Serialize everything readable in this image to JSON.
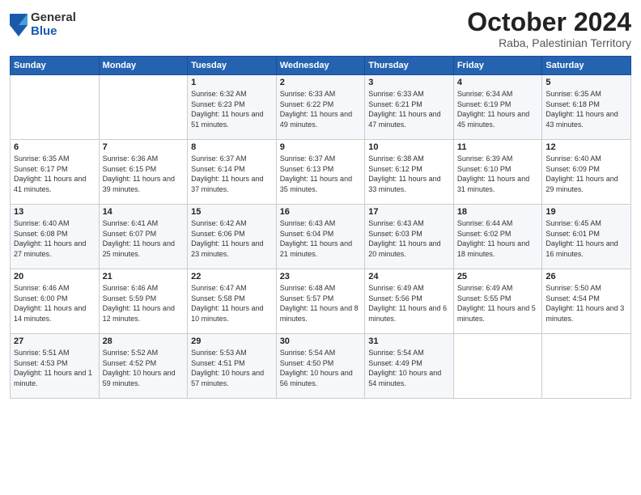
{
  "header": {
    "logo": {
      "general": "General",
      "blue": "Blue"
    },
    "title": "October 2024",
    "location": "Raba, Palestinian Territory"
  },
  "days_of_week": [
    "Sunday",
    "Monday",
    "Tuesday",
    "Wednesday",
    "Thursday",
    "Friday",
    "Saturday"
  ],
  "weeks": [
    [
      {
        "day": "",
        "sunrise": "",
        "sunset": "",
        "daylight": ""
      },
      {
        "day": "",
        "sunrise": "",
        "sunset": "",
        "daylight": ""
      },
      {
        "day": "1",
        "sunrise": "Sunrise: 6:32 AM",
        "sunset": "Sunset: 6:23 PM",
        "daylight": "Daylight: 11 hours and 51 minutes."
      },
      {
        "day": "2",
        "sunrise": "Sunrise: 6:33 AM",
        "sunset": "Sunset: 6:22 PM",
        "daylight": "Daylight: 11 hours and 49 minutes."
      },
      {
        "day": "3",
        "sunrise": "Sunrise: 6:33 AM",
        "sunset": "Sunset: 6:21 PM",
        "daylight": "Daylight: 11 hours and 47 minutes."
      },
      {
        "day": "4",
        "sunrise": "Sunrise: 6:34 AM",
        "sunset": "Sunset: 6:19 PM",
        "daylight": "Daylight: 11 hours and 45 minutes."
      },
      {
        "day": "5",
        "sunrise": "Sunrise: 6:35 AM",
        "sunset": "Sunset: 6:18 PM",
        "daylight": "Daylight: 11 hours and 43 minutes."
      }
    ],
    [
      {
        "day": "6",
        "sunrise": "Sunrise: 6:35 AM",
        "sunset": "Sunset: 6:17 PM",
        "daylight": "Daylight: 11 hours and 41 minutes."
      },
      {
        "day": "7",
        "sunrise": "Sunrise: 6:36 AM",
        "sunset": "Sunset: 6:15 PM",
        "daylight": "Daylight: 11 hours and 39 minutes."
      },
      {
        "day": "8",
        "sunrise": "Sunrise: 6:37 AM",
        "sunset": "Sunset: 6:14 PM",
        "daylight": "Daylight: 11 hours and 37 minutes."
      },
      {
        "day": "9",
        "sunrise": "Sunrise: 6:37 AM",
        "sunset": "Sunset: 6:13 PM",
        "daylight": "Daylight: 11 hours and 35 minutes."
      },
      {
        "day": "10",
        "sunrise": "Sunrise: 6:38 AM",
        "sunset": "Sunset: 6:12 PM",
        "daylight": "Daylight: 11 hours and 33 minutes."
      },
      {
        "day": "11",
        "sunrise": "Sunrise: 6:39 AM",
        "sunset": "Sunset: 6:10 PM",
        "daylight": "Daylight: 11 hours and 31 minutes."
      },
      {
        "day": "12",
        "sunrise": "Sunrise: 6:40 AM",
        "sunset": "Sunset: 6:09 PM",
        "daylight": "Daylight: 11 hours and 29 minutes."
      }
    ],
    [
      {
        "day": "13",
        "sunrise": "Sunrise: 6:40 AM",
        "sunset": "Sunset: 6:08 PM",
        "daylight": "Daylight: 11 hours and 27 minutes."
      },
      {
        "day": "14",
        "sunrise": "Sunrise: 6:41 AM",
        "sunset": "Sunset: 6:07 PM",
        "daylight": "Daylight: 11 hours and 25 minutes."
      },
      {
        "day": "15",
        "sunrise": "Sunrise: 6:42 AM",
        "sunset": "Sunset: 6:06 PM",
        "daylight": "Daylight: 11 hours and 23 minutes."
      },
      {
        "day": "16",
        "sunrise": "Sunrise: 6:43 AM",
        "sunset": "Sunset: 6:04 PM",
        "daylight": "Daylight: 11 hours and 21 minutes."
      },
      {
        "day": "17",
        "sunrise": "Sunrise: 6:43 AM",
        "sunset": "Sunset: 6:03 PM",
        "daylight": "Daylight: 11 hours and 20 minutes."
      },
      {
        "day": "18",
        "sunrise": "Sunrise: 6:44 AM",
        "sunset": "Sunset: 6:02 PM",
        "daylight": "Daylight: 11 hours and 18 minutes."
      },
      {
        "day": "19",
        "sunrise": "Sunrise: 6:45 AM",
        "sunset": "Sunset: 6:01 PM",
        "daylight": "Daylight: 11 hours and 16 minutes."
      }
    ],
    [
      {
        "day": "20",
        "sunrise": "Sunrise: 6:46 AM",
        "sunset": "Sunset: 6:00 PM",
        "daylight": "Daylight: 11 hours and 14 minutes."
      },
      {
        "day": "21",
        "sunrise": "Sunrise: 6:46 AM",
        "sunset": "Sunset: 5:59 PM",
        "daylight": "Daylight: 11 hours and 12 minutes."
      },
      {
        "day": "22",
        "sunrise": "Sunrise: 6:47 AM",
        "sunset": "Sunset: 5:58 PM",
        "daylight": "Daylight: 11 hours and 10 minutes."
      },
      {
        "day": "23",
        "sunrise": "Sunrise: 6:48 AM",
        "sunset": "Sunset: 5:57 PM",
        "daylight": "Daylight: 11 hours and 8 minutes."
      },
      {
        "day": "24",
        "sunrise": "Sunrise: 6:49 AM",
        "sunset": "Sunset: 5:56 PM",
        "daylight": "Daylight: 11 hours and 6 minutes."
      },
      {
        "day": "25",
        "sunrise": "Sunrise: 6:49 AM",
        "sunset": "Sunset: 5:55 PM",
        "daylight": "Daylight: 11 hours and 5 minutes."
      },
      {
        "day": "26",
        "sunrise": "Sunrise: 5:50 AM",
        "sunset": "Sunset: 4:54 PM",
        "daylight": "Daylight: 11 hours and 3 minutes."
      }
    ],
    [
      {
        "day": "27",
        "sunrise": "Sunrise: 5:51 AM",
        "sunset": "Sunset: 4:53 PM",
        "daylight": "Daylight: 11 hours and 1 minute."
      },
      {
        "day": "28",
        "sunrise": "Sunrise: 5:52 AM",
        "sunset": "Sunset: 4:52 PM",
        "daylight": "Daylight: 10 hours and 59 minutes."
      },
      {
        "day": "29",
        "sunrise": "Sunrise: 5:53 AM",
        "sunset": "Sunset: 4:51 PM",
        "daylight": "Daylight: 10 hours and 57 minutes."
      },
      {
        "day": "30",
        "sunrise": "Sunrise: 5:54 AM",
        "sunset": "Sunset: 4:50 PM",
        "daylight": "Daylight: 10 hours and 56 minutes."
      },
      {
        "day": "31",
        "sunrise": "Sunrise: 5:54 AM",
        "sunset": "Sunset: 4:49 PM",
        "daylight": "Daylight: 10 hours and 54 minutes."
      },
      {
        "day": "",
        "sunrise": "",
        "sunset": "",
        "daylight": ""
      },
      {
        "day": "",
        "sunrise": "",
        "sunset": "",
        "daylight": ""
      }
    ]
  ]
}
